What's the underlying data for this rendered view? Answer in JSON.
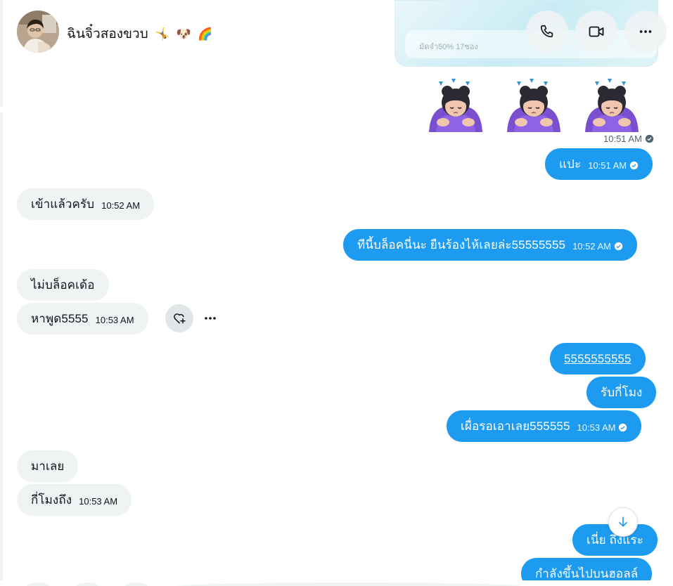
{
  "header": {
    "contact_name": "ฉินจิ๋วสองขวบ",
    "name_emojis": [
      "🤸",
      "🐶",
      "🌈"
    ],
    "call_button": "phone-icon",
    "video_button": "video-icon",
    "more_button": "more-icon"
  },
  "preview": {
    "text": "มัดจำ50% 17ซอง"
  },
  "stickers": {
    "count": 3,
    "time": "10:51 AM"
  },
  "messages": [
    {
      "dir": "out",
      "text": "แปะ",
      "time": "10:51 AM",
      "read": true
    },
    {
      "dir": "in",
      "text": "เข้าแล้วครับ",
      "time": "10:52 AM"
    },
    {
      "dir": "out",
      "text": "ทีนี้บล็อคนี่นะ ยืนร้องไห้เลยล่ะ55555555",
      "time": "10:52 AM",
      "read": true
    },
    {
      "dir": "in",
      "text": "ไม่บล็อคเด้อ",
      "time": ""
    },
    {
      "dir": "in",
      "text": "หาพูด5555",
      "time": "10:53 AM"
    },
    {
      "dir": "out",
      "text": "5555555555",
      "time": "",
      "underline": true
    },
    {
      "dir": "out",
      "text": "รับกี่โมง",
      "time": ""
    },
    {
      "dir": "out",
      "text": "เผื่อรอเอาเลย555555",
      "time": "10:53 AM",
      "read": true
    },
    {
      "dir": "in",
      "text": "มาเลย",
      "time": ""
    },
    {
      "dir": "in",
      "text": "กี่โมงถึง",
      "time": "10:53 AM"
    },
    {
      "dir": "out",
      "text": "เนี่ย ถึงแระ",
      "time": ""
    },
    {
      "dir": "out",
      "text": "กำลังขึ้นไปบนฮอลล์",
      "time": ""
    }
  ],
  "actions": {
    "react": "heart-plus-icon",
    "more": "more-icon",
    "scroll": "arrow-down-icon"
  },
  "colors": {
    "accent": "#1d9bf0",
    "incoming": "#eff3f4",
    "text": "#0f1419",
    "muted": "#536471"
  }
}
